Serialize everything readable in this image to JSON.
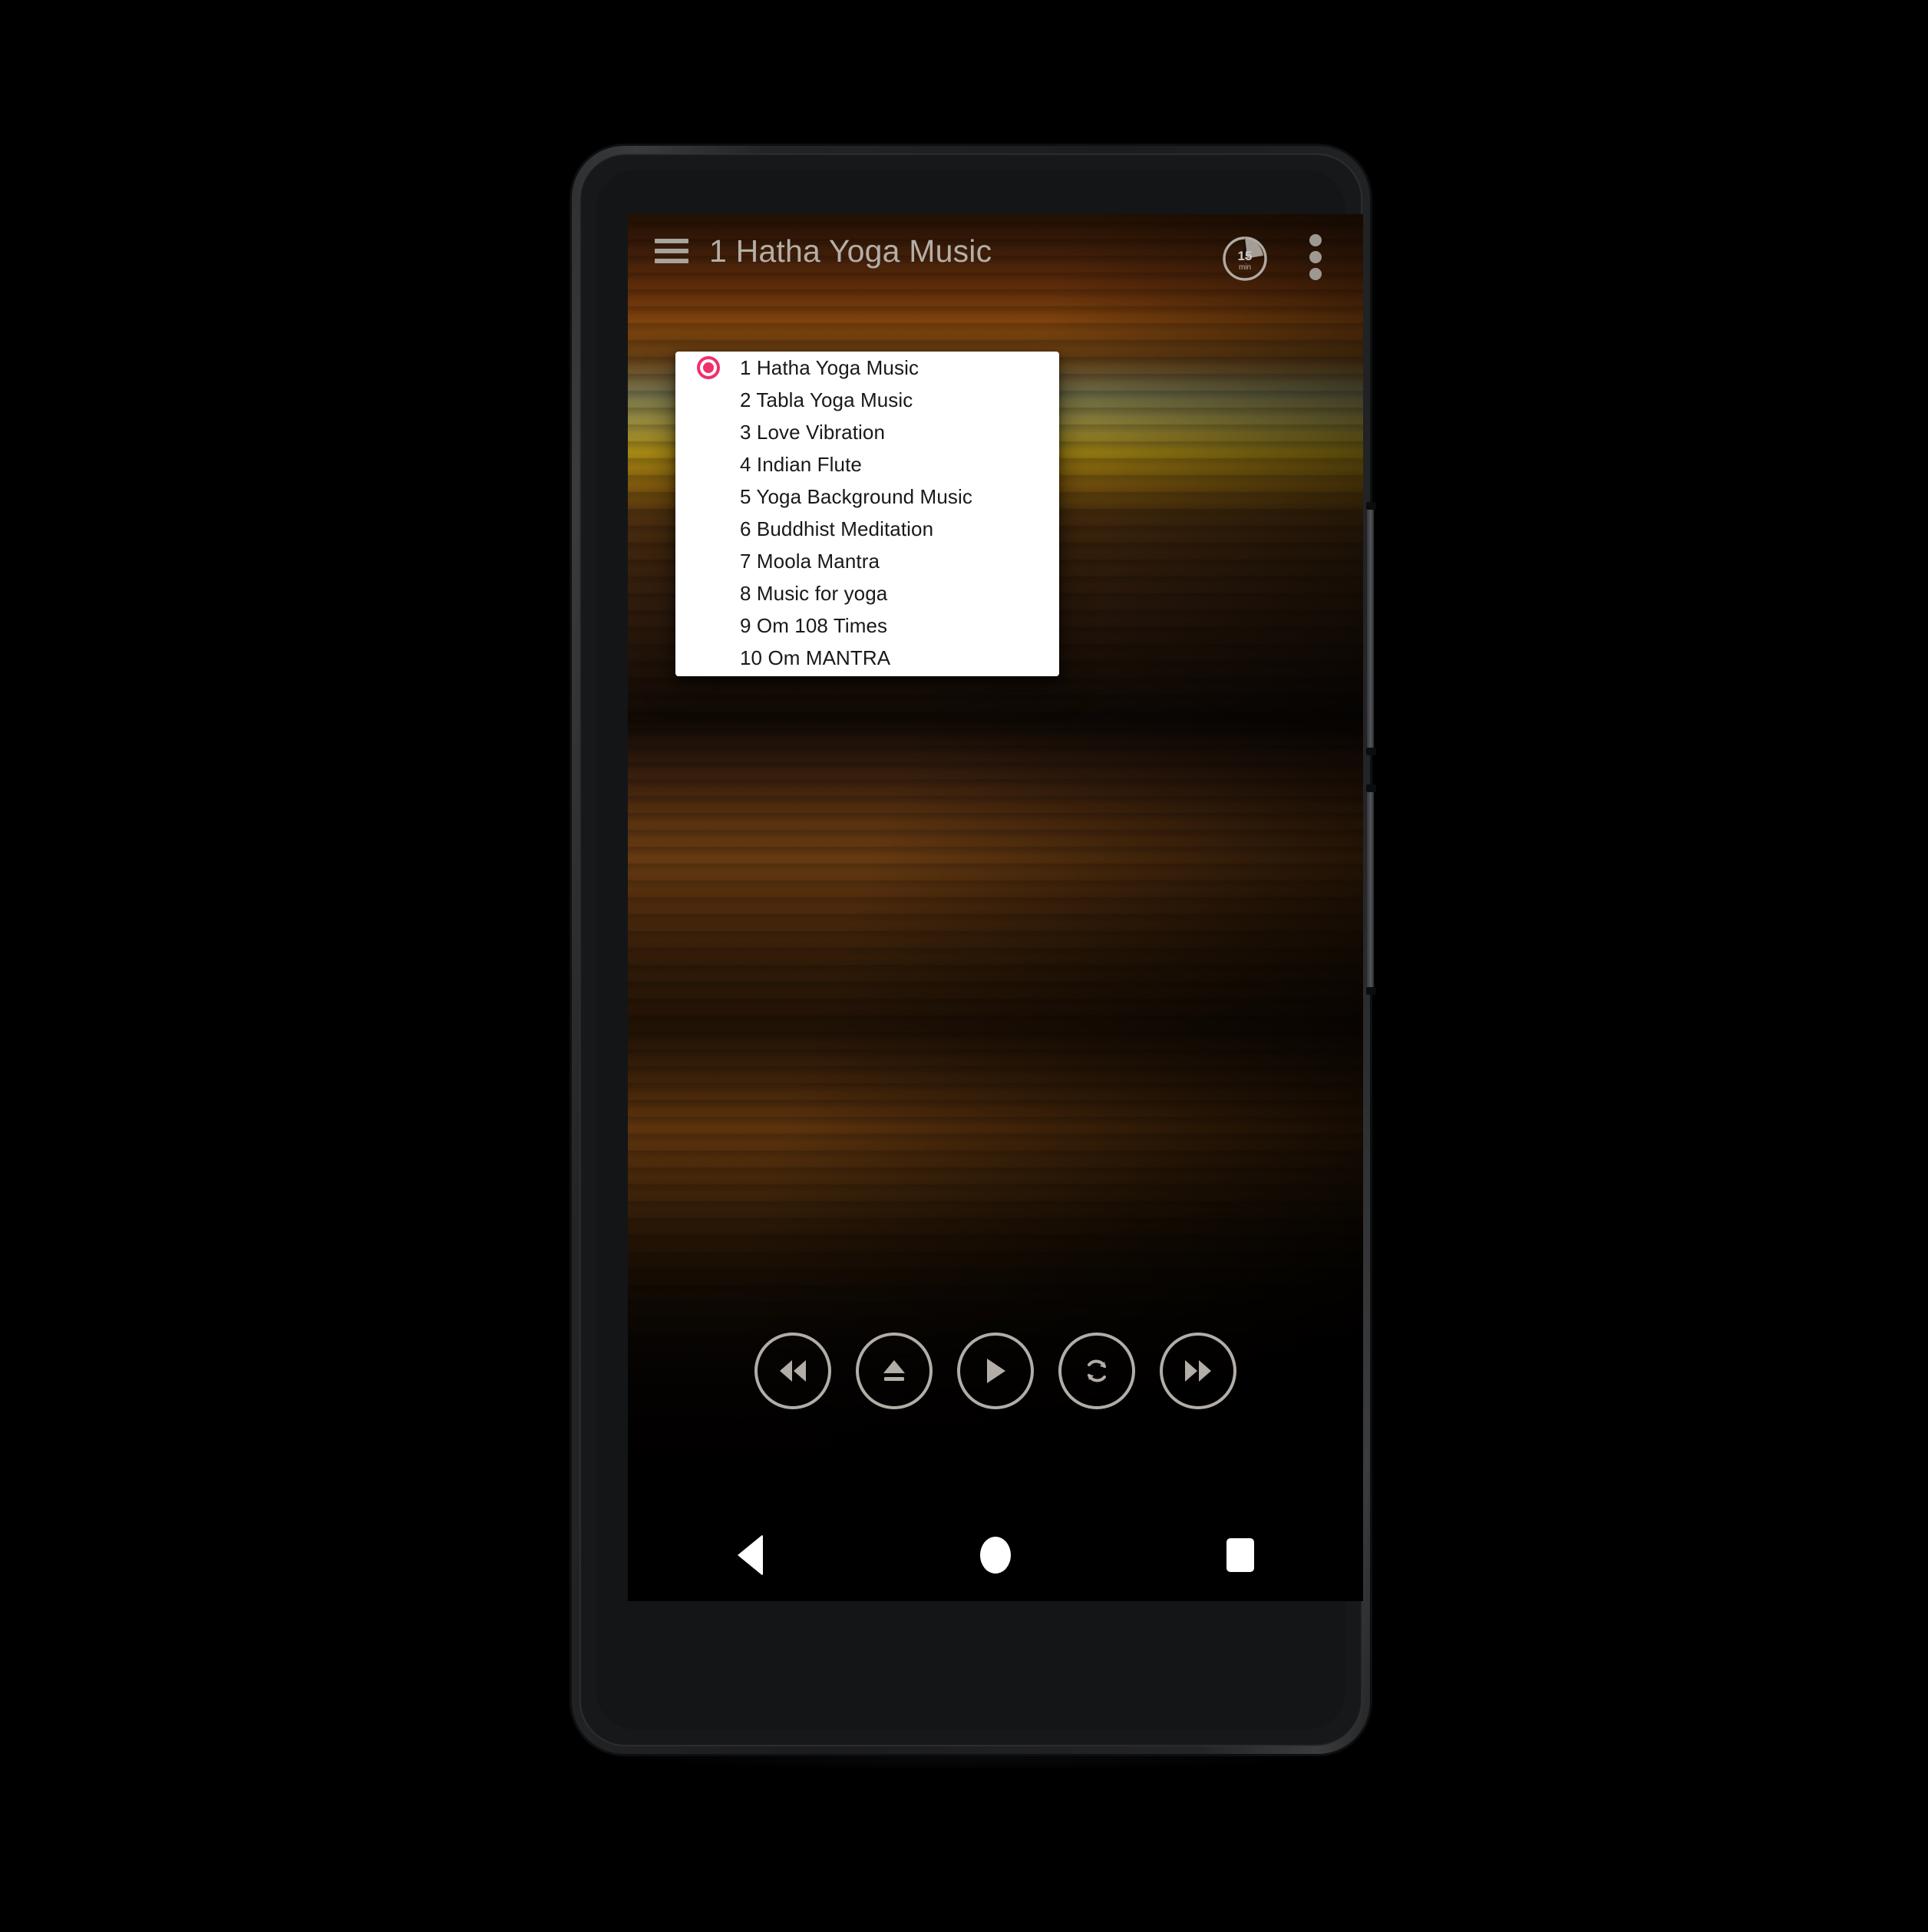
{
  "app": {
    "title": "1 Hatha Yoga Music",
    "menu_icon": "hamburger-menu-icon",
    "overflow_icon": "more-vert-icon",
    "timer": {
      "icon": "sleep-timer-icon",
      "value": "15",
      "unit": "min"
    }
  },
  "dialog": {
    "selected_index": 0,
    "items": [
      {
        "label": "1 Hatha Yoga Music",
        "selected": true
      },
      {
        "label": "2 Tabla Yoga Music",
        "selected": false
      },
      {
        "label": "3 Love Vibration",
        "selected": false
      },
      {
        "label": "4 Indian Flute",
        "selected": false
      },
      {
        "label": "5 Yoga Background Music",
        "selected": false
      },
      {
        "label": "6 Buddhist Meditation",
        "selected": false
      },
      {
        "label": "7 Moola Mantra",
        "selected": false
      },
      {
        "label": "8 Music for yoga",
        "selected": false
      },
      {
        "label": "9 Om 108 Times",
        "selected": false
      },
      {
        "label": "10 Om MANTRA",
        "selected": false
      }
    ]
  },
  "player": {
    "controls": [
      {
        "name": "rewind-button",
        "icon": "rewind-icon"
      },
      {
        "name": "eject-stop-button",
        "icon": "eject-icon"
      },
      {
        "name": "play-button",
        "icon": "play-icon"
      },
      {
        "name": "repeat-button",
        "icon": "repeat-icon"
      },
      {
        "name": "fast-forward-button",
        "icon": "fast-forward-icon"
      }
    ]
  },
  "navbar": {
    "back": "back-icon",
    "home": "home-icon",
    "recents": "recents-icon"
  },
  "colors": {
    "accent_pink": "#F0306B",
    "appbar_text": "#B4AEA7",
    "dialog_bg": "#FFFFFF",
    "dialog_text": "#18191A",
    "control_stroke": "#B2ADA7",
    "background_top": "#2A1403",
    "background_horizon": "#C9A417",
    "background_bottom": "#000000"
  }
}
